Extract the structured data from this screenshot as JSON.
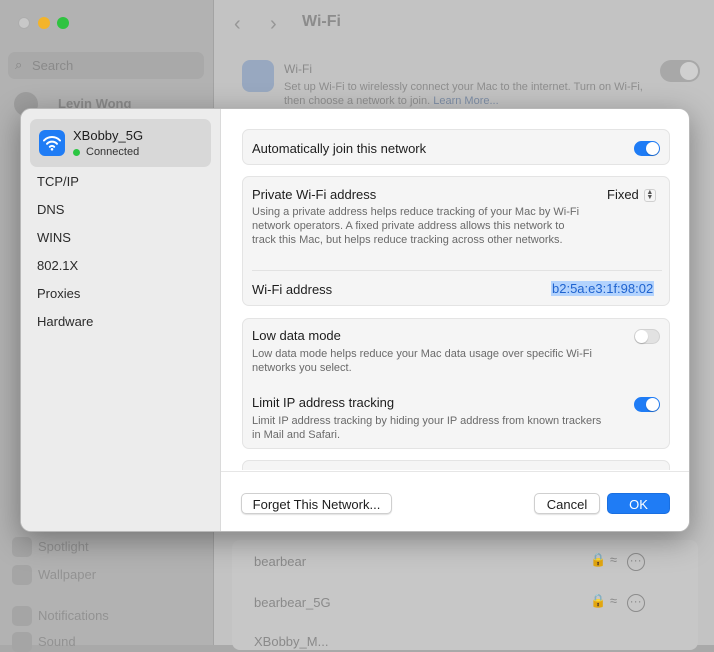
{
  "background": {
    "search_placeholder": "Search",
    "user_name": "Levin Wong",
    "title": "Wi-Fi",
    "wifi_title": "Wi-Fi",
    "wifi_desc": "Set up Wi-Fi to wirelessly connect your Mac to the internet. Turn on Wi-Fi, then choose a network to join.",
    "wifi_link": "Learn More...",
    "sidebar_bottom": [
      "Spotlight",
      "Wallpaper",
      "Notifications",
      "Sound"
    ],
    "networks": [
      "bearbear",
      "bearbear_5G",
      "XBobby_M..."
    ]
  },
  "dialog": {
    "network": {
      "name": "XBobby_5G",
      "status": "Connected"
    },
    "sidebar_items": [
      "TCP/IP",
      "DNS",
      "WINS",
      "802.1X",
      "Proxies",
      "Hardware"
    ],
    "auto_join": {
      "label": "Automatically join this network",
      "on": true
    },
    "private_address": {
      "label": "Private Wi-Fi address",
      "desc": "Using a private address helps reduce tracking of your Mac by Wi-Fi network operators. A fixed private address allows this network to track this Mac, but helps reduce tracking across other networks.",
      "value": "Fixed"
    },
    "wifi_address": {
      "label": "Wi-Fi address",
      "value": "b2:5a:e3:1f:98:02"
    },
    "low_data": {
      "label": "Low data mode",
      "desc": "Low data mode helps reduce your Mac data usage over specific Wi-Fi networks you select.",
      "on": false
    },
    "limit_ip": {
      "label": "Limit IP address tracking",
      "desc": "Limit IP address tracking by hiding your IP address from known trackers in Mail and Safari.",
      "on": true
    },
    "buttons": {
      "forget": "Forget This Network...",
      "cancel": "Cancel",
      "ok": "OK"
    }
  },
  "colors": {
    "accent": "#1f7cf5",
    "connected": "#2ac642"
  }
}
